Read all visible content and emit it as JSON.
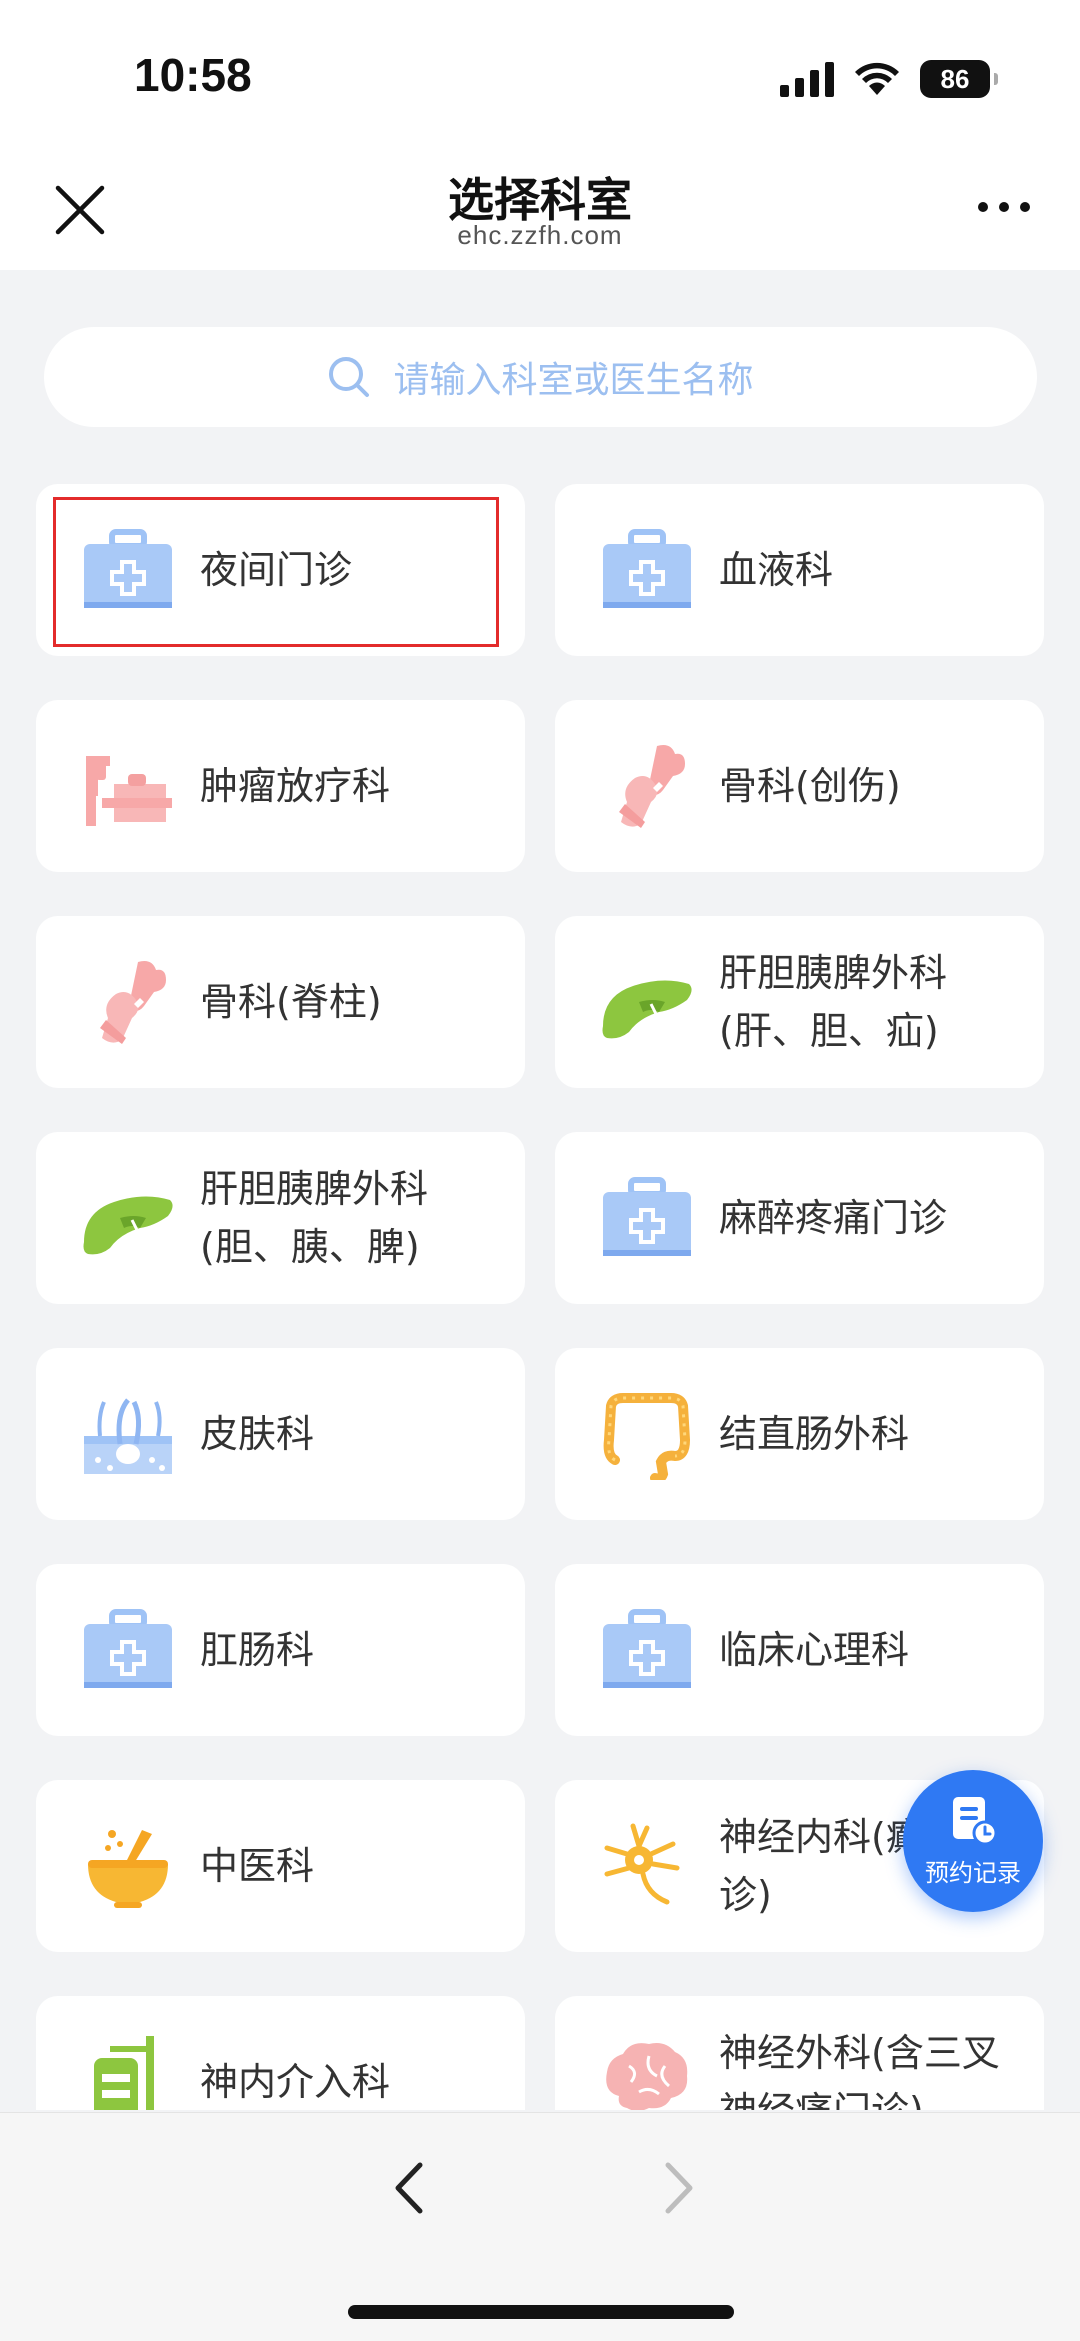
{
  "status": {
    "time": "10:58",
    "battery": "86"
  },
  "nav": {
    "title": "选择科室",
    "subtitle": "ehc.zzfh.com"
  },
  "search": {
    "placeholder": "请输入科室或医生名称"
  },
  "departments": [
    {
      "label": "夜间门诊",
      "icon": "medical-kit-icon"
    },
    {
      "label": "血液科",
      "icon": "medical-kit-icon"
    },
    {
      "label": "肿瘤放疗科",
      "icon": "radiotherapy-machine-icon"
    },
    {
      "label": "骨科(创伤)",
      "icon": "bone-joint-icon"
    },
    {
      "label": "骨科(脊柱)",
      "icon": "bone-joint-icon"
    },
    {
      "label": "肝胆胰脾外科(肝、胆、疝)",
      "icon": "liver-icon"
    },
    {
      "label": "肝胆胰脾外科(胆、胰、脾)",
      "icon": "liver-icon"
    },
    {
      "label": "麻醉疼痛门诊",
      "icon": "medical-kit-icon"
    },
    {
      "label": "皮肤科",
      "icon": "skin-hair-icon"
    },
    {
      "label": "结直肠外科",
      "icon": "colon-icon"
    },
    {
      "label": "肛肠科",
      "icon": "medical-kit-icon"
    },
    {
      "label": "临床心理科",
      "icon": "medical-kit-icon"
    },
    {
      "label": "中医科",
      "icon": "mortar-pestle-icon"
    },
    {
      "label": "神经内科(癫痫门诊)",
      "icon": "neuron-icon"
    },
    {
      "label": "神内介入科",
      "icon": "iv-drip-icon"
    },
    {
      "label": "神经外科(含三叉神经痛门诊)",
      "icon": "brain-icon"
    }
  ],
  "fab": {
    "label": "预约记录",
    "icon": "document-clock-icon"
  },
  "colors": {
    "accent": "#2f79f3",
    "card": "#ffffff",
    "background": "#f2f3f5",
    "highlight": "#e32b2b"
  }
}
